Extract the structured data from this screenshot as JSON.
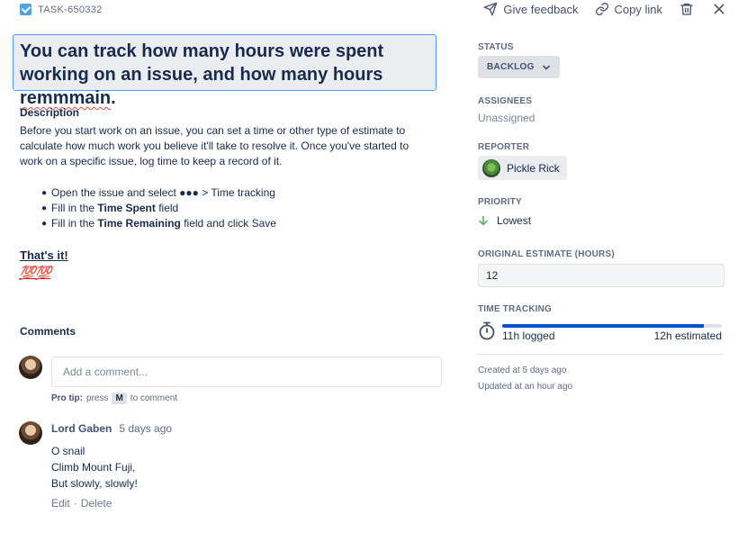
{
  "colors": {
    "accent": "#0052cc",
    "focus": "#4c9aff",
    "error": "#e5493a",
    "emoji_red": "#d0112b"
  },
  "header": {
    "task_id": "TASK-650332",
    "feedback_label": "Give feedback",
    "copy_label": "Copy link",
    "icons": [
      "send-icon",
      "link-icon",
      "trash-icon",
      "close-icon"
    ]
  },
  "issue": {
    "title_before": "You can track how many hours were spent working on an issue, and how many hours ",
    "title_misspelled": "remmmain",
    "title_after": "."
  },
  "description": {
    "heading": "Description",
    "body": "Before you start work on an issue, you can set a time or other type of estimate to calculate how much work you believe it'll take to resolve it. Once you've started to work on a specific issue, log time to keep a record of it.",
    "list": [
      {
        "text": "Open the issue and select ●●● > Time tracking"
      },
      {
        "prefix": "Fill in the ",
        "bold": "Time Spent",
        "suffix": " field"
      },
      {
        "prefix": "Fill in the ",
        "bold": "Time Remaining",
        "suffix": " field and click Save"
      }
    ],
    "closing": "That's it!",
    "emoji": "💯💯"
  },
  "comments": {
    "heading": "Comments",
    "input_placeholder": "Add a comment...",
    "pro_tip_label": "Pro tip:",
    "pro_tip_press": "press",
    "pro_tip_key": "M",
    "pro_tip_suffix": "to comment",
    "items": [
      {
        "author": "Lord Gaben",
        "time": "5 days ago",
        "lines": [
          "O snail",
          "Climb Mount Fuji,",
          "But slowly, slowly!"
        ],
        "edit_label": "Edit",
        "separator": "·",
        "delete_label": "Delete"
      }
    ]
  },
  "sidebar": {
    "status_label": "Status",
    "status_value": "BACKLOG",
    "assignees_label": "Assignees",
    "assignees_value": "Unassigned",
    "reporter_label": "Reporter",
    "reporter_name": "Pickle Rick",
    "priority_label": "Priority",
    "priority_value": "Lowest",
    "estimate_label": "Original Estimate (Hours)",
    "estimate_value": "12",
    "time_tracking_label": "Time Tracking",
    "time_logged": "11h logged",
    "time_estimated": "12h estimated",
    "time_progress_fraction": 0.917,
    "created": "Created at 5 days ago",
    "updated": "Updated at an hour ago"
  }
}
